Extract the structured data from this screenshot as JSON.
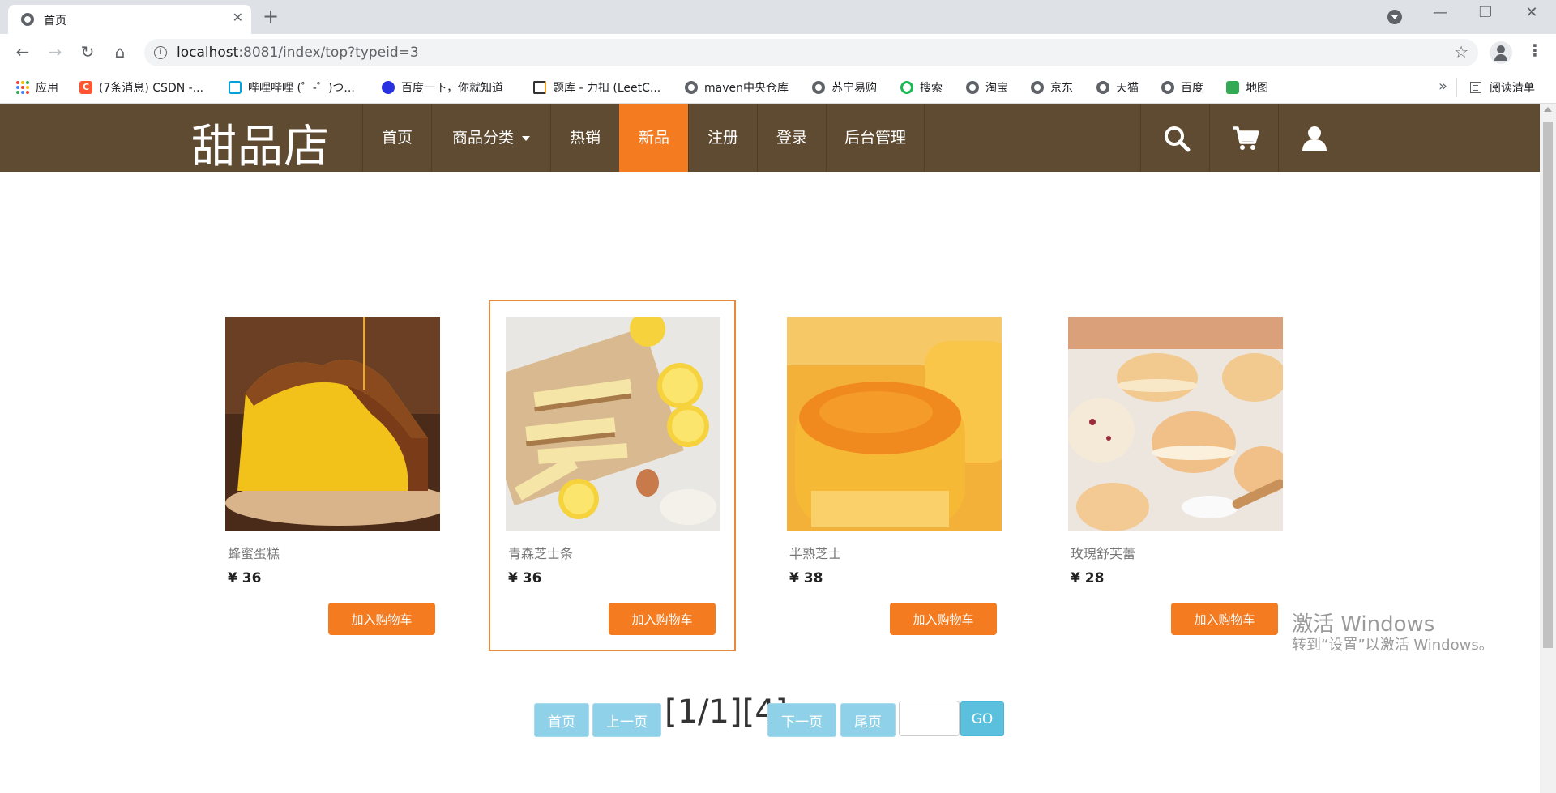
{
  "browser": {
    "tab_title": "首页",
    "tab_close": "✕",
    "new_tab": "+",
    "url_host": "localhost",
    "url_rest": ":8081/index/top?typeid=3",
    "window_controls": [
      "—",
      "❐",
      "✕"
    ]
  },
  "bookmarks": [
    {
      "label": "应用",
      "icon": "apps-icon"
    },
    {
      "label": "(7条消息) CSDN -...",
      "icon": "csdn-icon"
    },
    {
      "label": "哔哩哔哩 (゜-゜)つ...",
      "icon": "bilibili-icon"
    },
    {
      "label": "百度一下，你就知道",
      "icon": "baidu-icon"
    },
    {
      "label": "题库 - 力扣 (LeetC...",
      "icon": "leetcode-icon"
    },
    {
      "label": "maven中央仓库",
      "icon": "globe-icon"
    },
    {
      "label": "苏宁易购",
      "icon": "globe-icon"
    },
    {
      "label": "搜索",
      "icon": "search360-icon"
    },
    {
      "label": "淘宝",
      "icon": "globe-icon"
    },
    {
      "label": "京东",
      "icon": "globe-icon"
    },
    {
      "label": "天猫",
      "icon": "globe-icon"
    },
    {
      "label": "百度",
      "icon": "globe-icon"
    },
    {
      "label": "地图",
      "icon": "map-icon"
    }
  ],
  "bookmarks_more": "»",
  "reading_list": "阅读清单",
  "site": {
    "brand": "甜品店",
    "nav": [
      {
        "label": "首页"
      },
      {
        "label": "商品分类"
      },
      {
        "label": "热销"
      },
      {
        "label": "新品",
        "active": true
      },
      {
        "label": "注册"
      },
      {
        "label": "登录"
      },
      {
        "label": "后台管理"
      }
    ],
    "accent_color": "#f47b20",
    "navbar_color": "#5f4b32"
  },
  "products": [
    {
      "name": "蜂蜜蛋糕",
      "price": "¥ 36",
      "button": "加入购物车"
    },
    {
      "name": "青森芝士条",
      "price": "¥ 36",
      "button": "加入购物车"
    },
    {
      "name": "半熟芝士",
      "price": "¥ 38",
      "button": "加入购物车"
    },
    {
      "name": "玫瑰舒芙蕾",
      "price": "¥ 28",
      "button": "加入购物车"
    }
  ],
  "pagination": {
    "first": "首页",
    "prev": "上一页",
    "info": "[1/1][4]",
    "next": "下一页",
    "last": "尾页",
    "input_value": "",
    "go": "GO"
  },
  "watermark": {
    "line1": "激活 Windows",
    "line2": "转到“设置”以激活 Windows。"
  }
}
